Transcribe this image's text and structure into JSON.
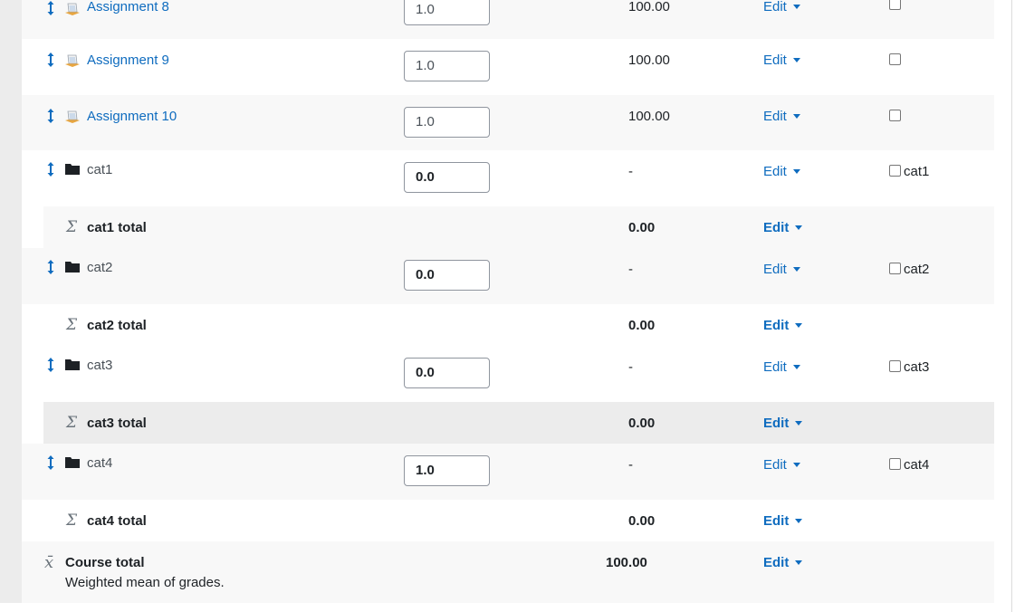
{
  "rows": [
    {
      "name": "Assignment 8",
      "weight": "1.0",
      "max_grade": "100.00",
      "edit": "Edit"
    },
    {
      "name": "Assignment 9",
      "weight": "1.0",
      "max_grade": "100.00",
      "edit": "Edit"
    },
    {
      "name": "Assignment 10",
      "weight": "1.0",
      "max_grade": "100.00",
      "edit": "Edit"
    },
    {
      "name": "cat1",
      "weight": "0.0",
      "max_grade": "-",
      "edit": "Edit",
      "checkbox_label": "cat1"
    },
    {
      "name": "cat1 total",
      "max_grade": "0.00",
      "edit": "Edit"
    },
    {
      "name": "cat2",
      "weight": "0.0",
      "max_grade": "-",
      "edit": "Edit",
      "checkbox_label": "cat2"
    },
    {
      "name": "cat2 total",
      "max_grade": "0.00",
      "edit": "Edit"
    },
    {
      "name": "cat3",
      "weight": "0.0",
      "max_grade": "-",
      "edit": "Edit",
      "checkbox_label": "cat3"
    },
    {
      "name": "cat3 total",
      "max_grade": "0.00",
      "edit": "Edit"
    },
    {
      "name": "cat4",
      "weight": "1.0",
      "max_grade": "-",
      "edit": "Edit",
      "checkbox_label": "cat4"
    },
    {
      "name": "cat4 total",
      "max_grade": "0.00",
      "edit": "Edit"
    }
  ],
  "course_total": {
    "name": "Course total",
    "aggregation": "Weighted mean of grades.",
    "max_grade": "100.00",
    "edit": "Edit"
  },
  "icons": {
    "move": "move-icon",
    "assignment": "assignment-icon",
    "category": "folder-icon",
    "category_total": "sigma-icon",
    "course_total": "mean-icon"
  },
  "colors": {
    "link": "#0f6cbf",
    "row_light": "#f8f8f8",
    "row_grey": "#ececec",
    "border": "#dee2e6"
  }
}
